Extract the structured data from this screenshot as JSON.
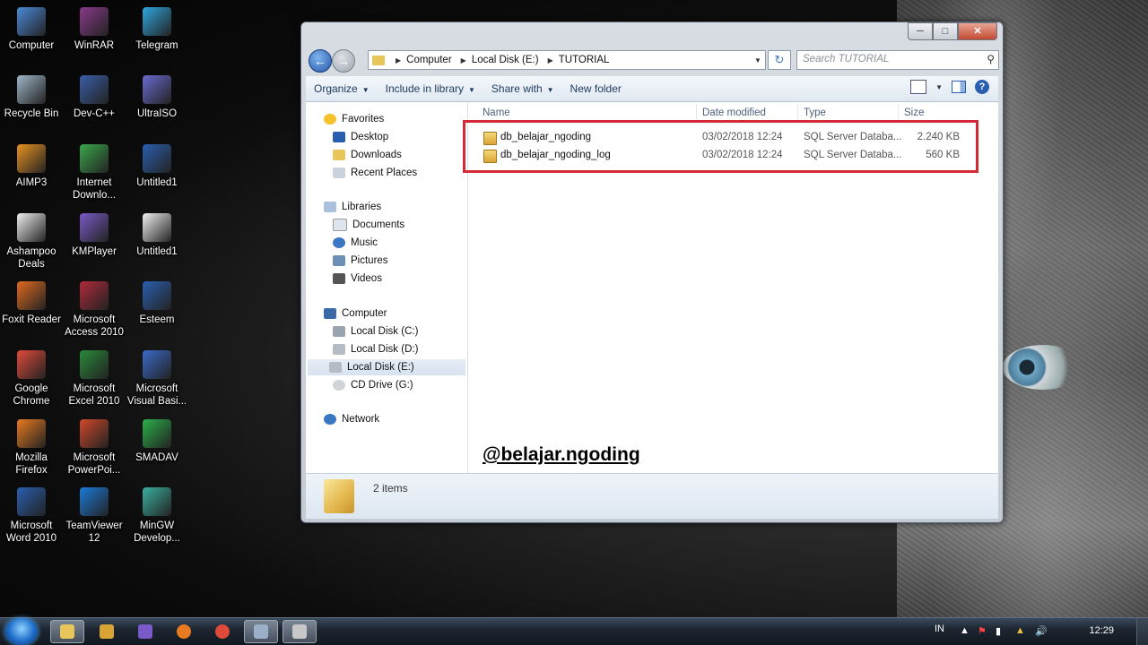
{
  "desktop": {
    "icons": [
      {
        "label": "Computer",
        "color": "#4a8ad9"
      },
      {
        "label": "WinRAR",
        "color": "#8a3a8a"
      },
      {
        "label": "Telegram",
        "color": "#2ea6de"
      },
      {
        "label": "Recycle Bin",
        "color": "#9fb6c8"
      },
      {
        "label": "Dev-C++",
        "color": "#3a5ea8"
      },
      {
        "label": "UltraISO",
        "color": "#6a6ad0"
      },
      {
        "label": "AIMP3",
        "color": "#e89320"
      },
      {
        "label": "Internet Downlo...",
        "color": "#3aa84a"
      },
      {
        "label": "Untitled1",
        "color": "#2a5fb0"
      },
      {
        "label": "Ashampoo Deals",
        "color": "#eeeeee"
      },
      {
        "label": "KMPlayer",
        "color": "#7a5ac8"
      },
      {
        "label": "Untitled1",
        "color": "#f0f0f0"
      },
      {
        "label": "Foxit Reader",
        "color": "#e06a20"
      },
      {
        "label": "Microsoft Access 2010",
        "color": "#b02a3a"
      },
      {
        "label": "Esteem",
        "color": "#2a5fb0"
      },
      {
        "label": "Google Chrome",
        "color": "#e04a3a"
      },
      {
        "label": "Microsoft Excel 2010",
        "color": "#2a8a3a"
      },
      {
        "label": "Microsoft Visual Basi...",
        "color": "#3a6ac8"
      },
      {
        "label": "Mozilla Firefox",
        "color": "#e87a20"
      },
      {
        "label": "Microsoft PowerPoi...",
        "color": "#d0482a"
      },
      {
        "label": "SMADAV",
        "color": "#2ab04a"
      },
      {
        "label": "Microsoft Word 2010",
        "color": "#2a5fb0"
      },
      {
        "label": "TeamViewer 12",
        "color": "#1a7ad8"
      },
      {
        "label": "MinGW Develop...",
        "color": "#3ab0a0"
      }
    ]
  },
  "window": {
    "caption": {
      "minimize": "─",
      "maximize": "□",
      "close": "✕"
    },
    "address": {
      "segments": [
        "Computer",
        "Local Disk (E:)",
        "TUTORIAL"
      ]
    },
    "search": {
      "placeholder": "Search TUTORIAL"
    },
    "toolbar": {
      "organize": "Organize",
      "include": "Include in library",
      "share": "Share with",
      "newfolder": "New folder"
    },
    "nav": {
      "favorites": "Favorites",
      "desktop": "Desktop",
      "downloads": "Downloads",
      "recent": "Recent Places",
      "libraries": "Libraries",
      "documents": "Documents",
      "music": "Music",
      "pictures": "Pictures",
      "videos": "Videos",
      "computer": "Computer",
      "diskC": "Local Disk (C:)",
      "diskD": "Local Disk (D:)",
      "diskE": "Local Disk (E:)",
      "cdG": "CD Drive (G:)",
      "network": "Network"
    },
    "columns": {
      "name": "Name",
      "date": "Date modified",
      "type": "Type",
      "size": "Size"
    },
    "files": [
      {
        "name": "db_belajar_ngoding",
        "date": "03/02/2018 12:24",
        "type": "SQL Server Databa...",
        "size": "2.240 KB"
      },
      {
        "name": "db_belajar_ngoding_log",
        "date": "03/02/2018 12:24",
        "type": "SQL Server Databa...",
        "size": "560 KB"
      }
    ],
    "watermark": "@belajar.ngoding",
    "status": {
      "items": "2 items"
    }
  },
  "taskbar": {
    "lang": "IN",
    "clock": "12:29"
  }
}
